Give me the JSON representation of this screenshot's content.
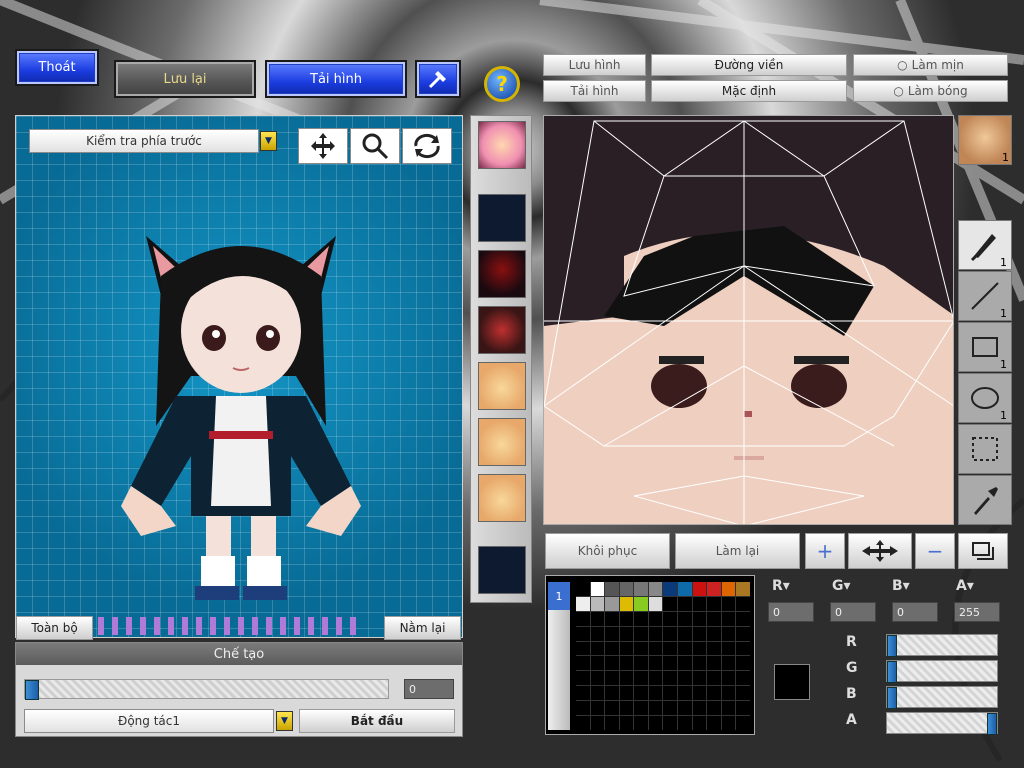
{
  "top_left": {
    "exit_label": "Thoát",
    "save_label": "Lưu lại",
    "load_label": "Tải hình"
  },
  "preview": {
    "view_mode": "Kiểm tra phía trước",
    "all_label": "Toàn bộ",
    "reset_label": "Nằm lại"
  },
  "create": {
    "header": "Chế tạo",
    "progress_value": "0",
    "action_select": "Động tác1",
    "start_label": "Bắt đầu"
  },
  "right_top": {
    "save_label": "Lưu hình",
    "load_label": "Tải hình",
    "outline_label": "Đường viền",
    "default_label": "Mặc định",
    "smooth_label": "Làm mịn",
    "shine_label": "Làm bóng"
  },
  "editor_actions": {
    "restore_label": "Khôi phục",
    "redo_label": "Làm lại"
  },
  "tools": {
    "pen_count": "1",
    "line_count": "1",
    "rect_count": "1",
    "ellipse_count": "1",
    "avatar_count": "1"
  },
  "color": {
    "r_value": "0",
    "g_value": "0",
    "b_value": "0",
    "a_value": "255",
    "current": "#000000",
    "palette": [
      "#000000",
      "#ffffff",
      "#555555",
      "#666666",
      "#777777",
      "#888888",
      "#0b3a7a",
      "#0e6aa8",
      "#cc1111",
      "#cc2222",
      "#dd6600",
      "#aa7722",
      "#eeeeee",
      "#bbbbbb",
      "#999999",
      "#ddbb00",
      "#88cc22",
      "#dddddd"
    ]
  },
  "palette_tab": "1"
}
